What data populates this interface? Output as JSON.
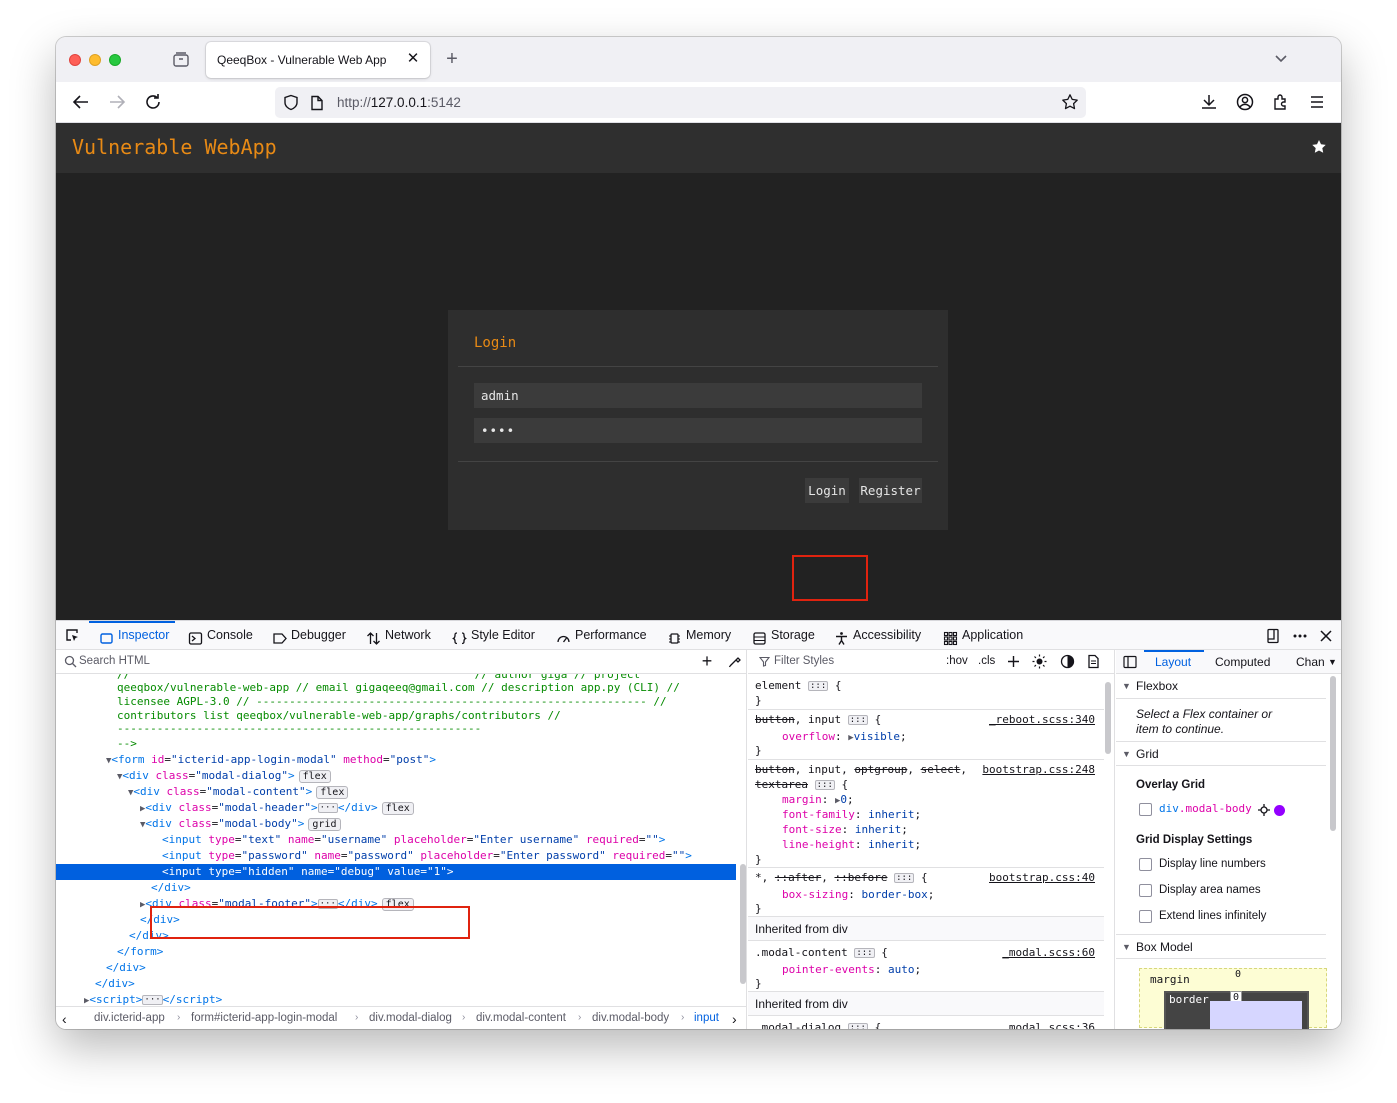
{
  "browser": {
    "tab_title": "QeeqBox - Vulnerable Web App",
    "new_tab_symbol": "+",
    "close_symbol": "✕",
    "url_scheme": "http://",
    "url_host": "127.0.0.1",
    "url_port": ":5142"
  },
  "page": {
    "app_title": "Vulnerable WebApp",
    "modal_title": "Login",
    "username_value": "admin",
    "password_value": "••••",
    "login_button": "Login",
    "register_button": "Register",
    "accent_color": "#e88a15"
  },
  "devtools": {
    "tabs": [
      "Inspector",
      "Console",
      "Debugger",
      "Network",
      "Style Editor",
      "Performance",
      "Memory",
      "Storage",
      "Accessibility",
      "Application"
    ],
    "search_placeholder": "Search HTML",
    "breadcrumbs": [
      "div.icterid-app",
      "form#icterid-app-login-modal",
      "div.modal-dialog",
      "div.modal-content",
      "div.modal-body",
      "input"
    ],
    "styles": {
      "filter_placeholder": "Filter Styles",
      "hov": ":hov",
      "cls": ".cls",
      "inherited_div_1": "Inherited from div",
      "inherited_div_2": "Inherited from div",
      "src_reboot": "_reboot.scss:340",
      "src_bootstrap_248": "bootstrap.css:248",
      "src_bootstrap_40": "bootstrap.css:40",
      "src_modal_60": "_modal.scss:60",
      "src_modal_36": "_modal.scss:36"
    },
    "layout": {
      "tab_layout": "Layout",
      "tab_computed": "Computed",
      "tab_changes": "Chan",
      "flexbox_header": "Flexbox",
      "flexbox_hint_1": "Select a Flex container or",
      "flexbox_hint_2": "item to continue.",
      "grid_header": "Grid",
      "overlay_grid": "Overlay Grid",
      "grid_element_tag": "div",
      "grid_element_class": ".modal-body",
      "grid_display_settings": "Grid Display Settings",
      "opt_line_numbers": "Display line numbers",
      "opt_area_names": "Display area names",
      "opt_extend_lines": "Extend lines infinitely",
      "box_model_header": "Box Model",
      "margin_label": "margin",
      "margin_value": "0",
      "border_label": "border",
      "border_value": "0"
    }
  }
}
